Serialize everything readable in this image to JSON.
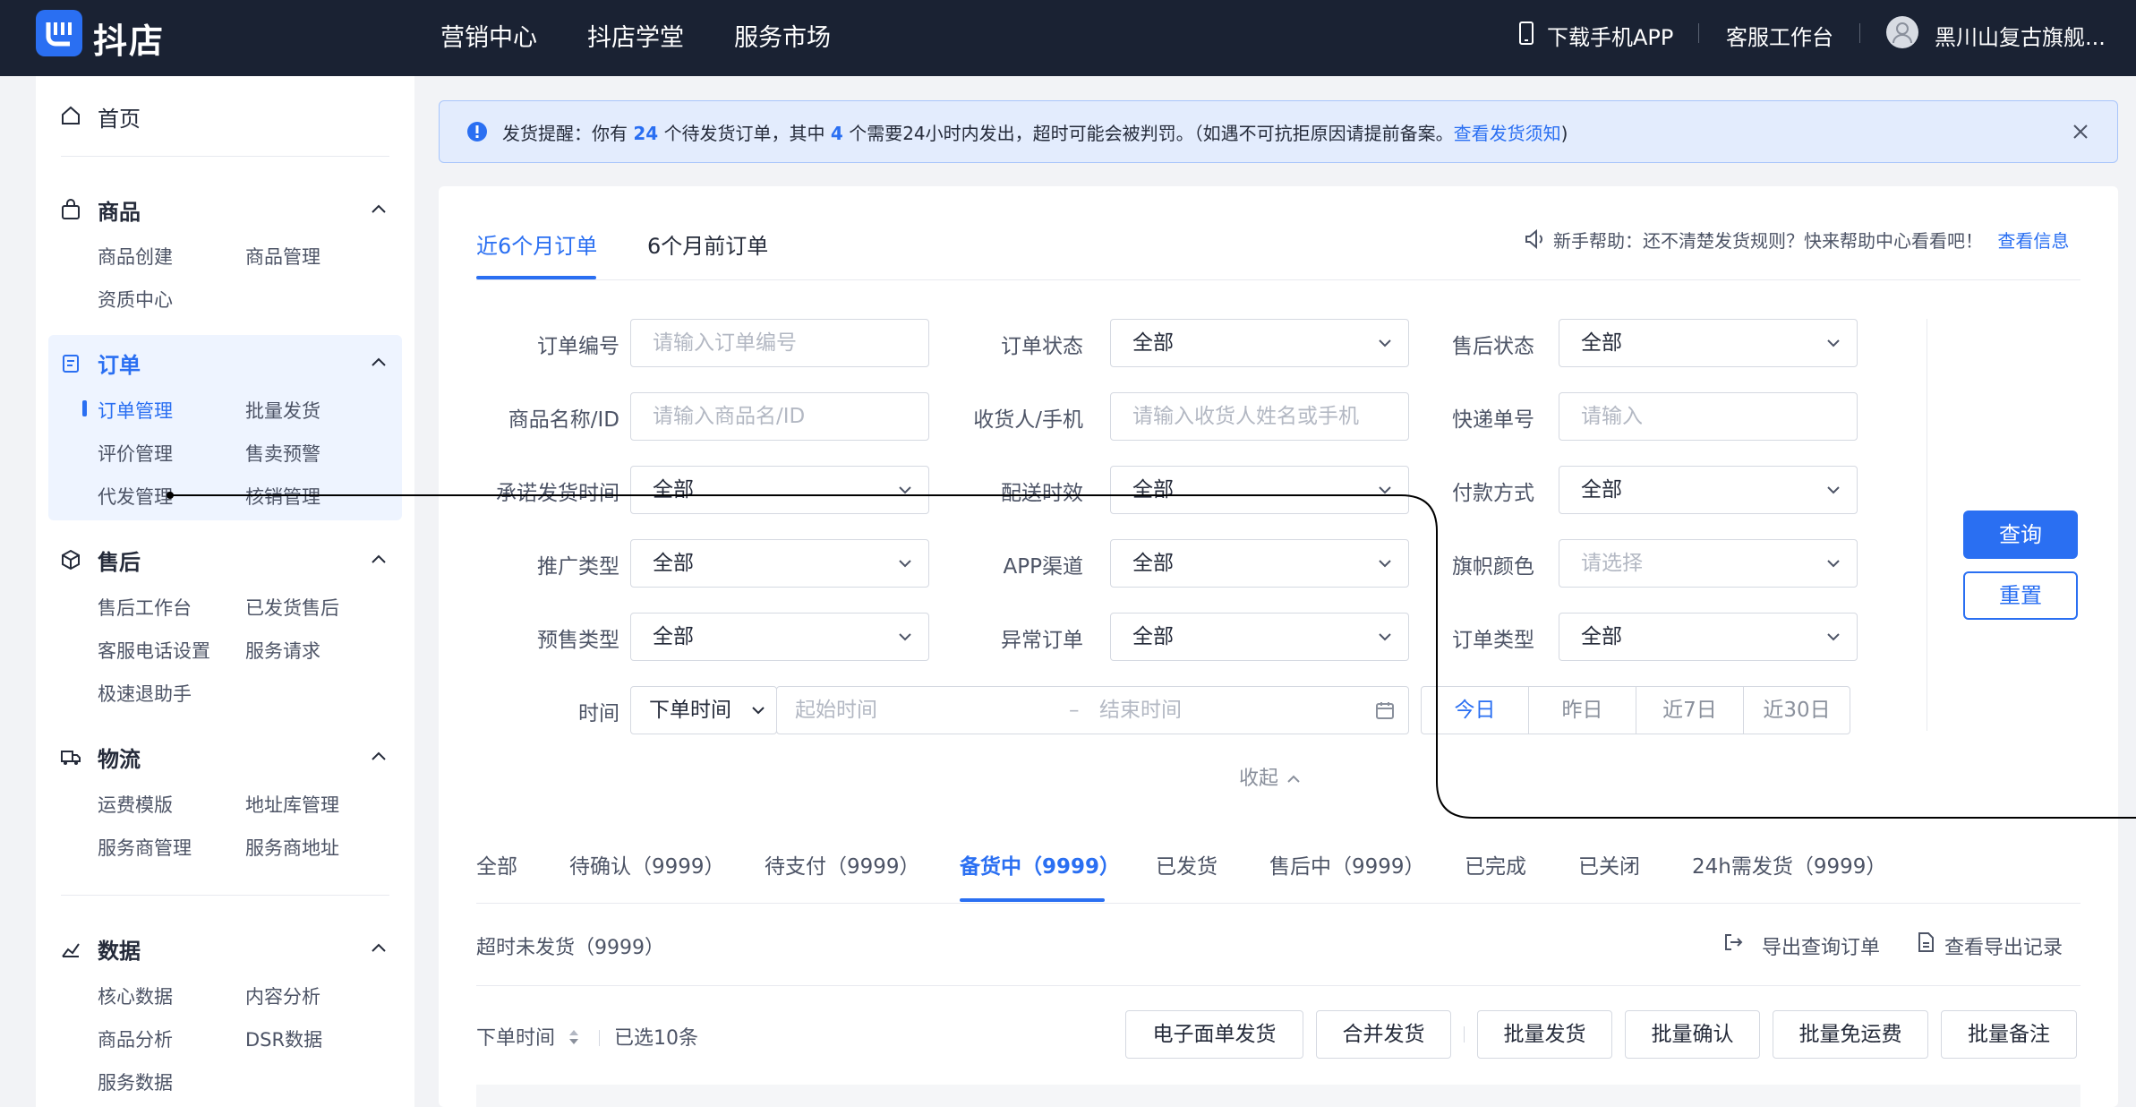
{
  "topbar": {
    "brand": "抖店",
    "nav": [
      "营销中心",
      "抖店学堂",
      "服务市场"
    ],
    "download_app": "下载手机APP",
    "service_desk": "客服工作台",
    "shop_name": "黑川山复古旗舰..."
  },
  "sidebar": {
    "home": "首页",
    "groups": [
      {
        "title": "商品",
        "items": [
          "商品创建",
          "商品管理",
          "资质中心"
        ]
      },
      {
        "title": "订单",
        "items": [
          "订单管理",
          "批量发货",
          "评价管理",
          "售卖预警",
          "代发管理",
          "核销管理"
        ]
      },
      {
        "title": "售后",
        "items": [
          "售后工作台",
          "已发货售后",
          "客服电话设置",
          "服务请求",
          "极速退助手"
        ]
      },
      {
        "title": "物流",
        "items": [
          "运费模版",
          "地址库管理",
          "服务商管理",
          "服务商地址"
        ]
      },
      {
        "title": "数据",
        "items": [
          "核心数据",
          "内容分析",
          "商品分析",
          "DSR数据",
          "服务数据"
        ]
      }
    ]
  },
  "notice": {
    "prefix": "发货提醒：你有",
    "pending_count": "24",
    "mid": "个待发货订单，其中",
    "urgent_count": "4",
    "suffix": "个需要24小时内发出，超时可能会被判罚。（如遇不可抗拒原因请提前备案。",
    "link": "查看发货须知",
    "close": ")"
  },
  "tabs": [
    "近6个月订单",
    "6个月前订单"
  ],
  "help": {
    "text": "新手帮助：还不清楚发货规则？快来帮助中心看看吧！",
    "link": "查看信息"
  },
  "filters": {
    "order_no": {
      "label": "订单编号",
      "placeholder": "请输入订单编号"
    },
    "order_status": {
      "label": "订单状态",
      "value": "全部"
    },
    "aftersale_status": {
      "label": "售后状态",
      "value": "全部"
    },
    "product": {
      "label": "商品名称/ID",
      "placeholder": "请输入商品名/ID"
    },
    "receiver": {
      "label": "收货人/手机",
      "placeholder": "请输入收货人姓名或手机"
    },
    "express_no": {
      "label": "快递单号",
      "placeholder": "请输入"
    },
    "promise_time": {
      "label": "承诺发货时间",
      "value": "全部"
    },
    "delivery": {
      "label": "配送时效",
      "value": "全部"
    },
    "payment": {
      "label": "付款方式",
      "value": "全部"
    },
    "promo": {
      "label": "推广类型",
      "value": "全部"
    },
    "app_channel": {
      "label": "APP渠道",
      "value": "全部"
    },
    "flag_color": {
      "label": "旗帜颜色",
      "placeholder": "请选择"
    },
    "presale": {
      "label": "预售类型",
      "value": "全部"
    },
    "abnormal": {
      "label": "异常订单",
      "value": "全部"
    },
    "order_type": {
      "label": "订单类型",
      "value": "全部"
    },
    "time": {
      "label": "时间",
      "type": "下单时间",
      "start": "起始时间",
      "dash": "–",
      "end": "结束时间"
    },
    "quick": [
      "今日",
      "昨日",
      "近7日",
      "近30日"
    ],
    "collapse": "收起"
  },
  "actions": {
    "query": "查询",
    "reset": "重置"
  },
  "status_tabs": [
    "全部",
    "待确认（9999）",
    "待支付（9999）",
    "备货中（9999）",
    "已发货",
    "售后中（9999）",
    "已完成",
    "已关闭",
    "24h需发货（9999）"
  ],
  "overdue": "超时未发货（9999）",
  "export": "导出查询订单",
  "view_export": "查看导出记录",
  "sort_label": "下单时间",
  "selected": "已选10条",
  "bulk": [
    "电子面单发货",
    "合并发货",
    "批量发货",
    "批量确认",
    "批量免运费",
    "批量备注"
  ],
  "colors": {
    "accent": "#2a6ff2",
    "topbar": "#1a2233"
  }
}
